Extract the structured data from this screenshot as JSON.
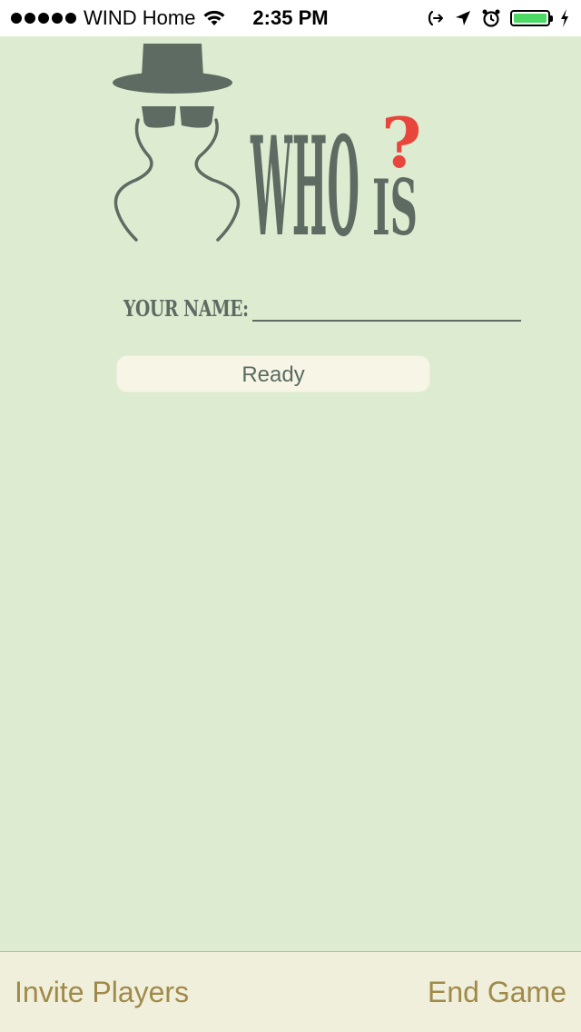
{
  "status_bar": {
    "carrier": "WIND Home",
    "time": "2:35 PM",
    "battery_color": "#4cd964"
  },
  "logo": {
    "word_who": "WHO",
    "word_is": "IS",
    "question_mark": "?",
    "icon": "detective-icon",
    "text_color": "#5e6b63",
    "accent_color": "#e8453c"
  },
  "form": {
    "name_label": "YOUR NAME:",
    "name_value": "",
    "ready_label": "Ready"
  },
  "toolbar": {
    "invite_label": "Invite Players",
    "end_label": "End Game",
    "tint_color": "#a08a4a"
  }
}
